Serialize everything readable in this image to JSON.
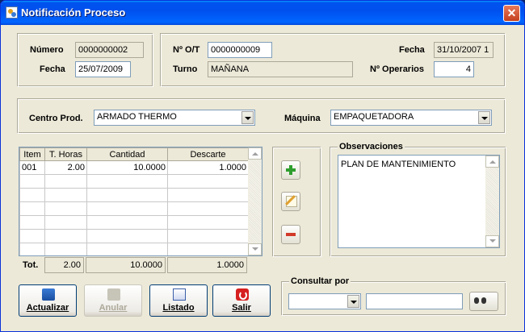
{
  "window": {
    "title": "Notificación Proceso",
    "close_symbol": "✕"
  },
  "header": {
    "numero_label": "Número",
    "numero_value": "0000000002",
    "fecha_label": "Fecha",
    "fecha_value": "25/07/2009",
    "ot_label": "Nº O/T",
    "ot_value": "0000000009",
    "turno_label": "Turno",
    "turno_value": "MAÑANA",
    "fecha2_label": "Fecha",
    "fecha2_value": "31/10/2007 1",
    "operarios_label": "Nº Operarios",
    "operarios_value": "4"
  },
  "centro": {
    "centro_label": "Centro Prod.",
    "centro_value": "ARMADO THERMO",
    "maquina_label": "Máquina",
    "maquina_value": "EMPAQUETADORA"
  },
  "grid": {
    "columns": [
      "Item",
      "T. Horas",
      "Cantidad",
      "Descarte"
    ],
    "rows": [
      {
        "item": "001",
        "horas": "2.00",
        "cantidad": "10.0000",
        "descarte": "1.0000"
      }
    ],
    "totals": {
      "label": "Tot.",
      "horas": "2.00",
      "cantidad": "10.0000",
      "descarte": "1.0000"
    }
  },
  "observaciones": {
    "title": "Observaciones",
    "text": "PLAN DE MANTENIMIENTO"
  },
  "buttons": {
    "actualizar": "Actualizar",
    "anular": "Anular",
    "listado": "Listado",
    "salir": "Salir"
  },
  "consultar": {
    "title": "Consultar por",
    "combo_value": "",
    "search_value": ""
  }
}
